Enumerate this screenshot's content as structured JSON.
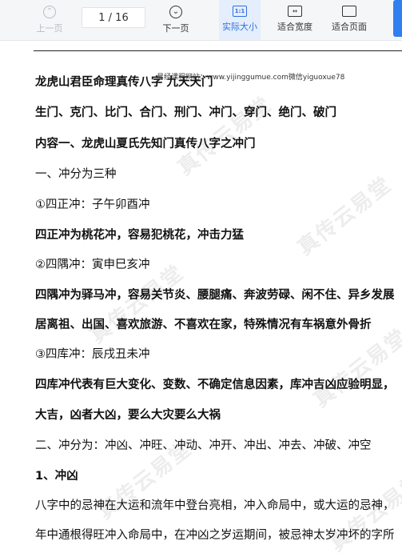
{
  "toolbar": {
    "prev_label": "上一页",
    "page_indicator": "1 / 16",
    "next_label": "下一页",
    "actual_size_label": "实际大小",
    "actual_size_icon_text": "1:1",
    "fit_width_label": "适合宽度",
    "fit_page_label": "适合页面",
    "icons": [
      "arrow-up-circle-icon",
      "arrow-down-circle-icon",
      "actual-size-icon",
      "fit-width-icon",
      "fit-page-icon"
    ],
    "accent_color": "#2f6fe0"
  },
  "document": {
    "watermark_small": "易经课程网站：www.yijinggumue.com微信yiguoxue78",
    "watermark_big": "真传云易堂",
    "lines": [
      "龙虎山君臣命理真传八字 九天天门",
      "生门、克门、比门、合门、刑门、冲门、穿门、绝门、破门",
      "内容一、龙虎山夏氏先知门真传八字之冲门",
      "一、冲分为三种",
      "①四正冲：子午卯酉冲",
      "四正冲为桃花冲，容易犯桃花，冲击力猛",
      "②四隅冲：寅申巳亥冲",
      "四隅冲为驿马冲，容易关节炎、腰腿痛、奔波劳碌、闲不住、异乡发展",
      "居离祖、出国、喜欢旅游、不喜欢在家，特殊情况有车祸意外骨折",
      "③四库冲：辰戌丑未冲",
      "四库冲代表有巨大变化、变数、不确定信息因素，库冲吉凶应验明显，",
      "大吉，凶者大凶，要么大灾要么大祸",
      "二、冲分为：冲凶、冲旺、冲动、冲开、冲出、冲去、冲破、冲空",
      "1、冲凶",
      "八字中的忌神在大运和流年中登台亮相，冲入命局中，或大运的忌神，",
      "年中通根得旺冲入命局中，在冲凶之岁运期间，被忌神太岁冲坏的字所"
    ]
  }
}
